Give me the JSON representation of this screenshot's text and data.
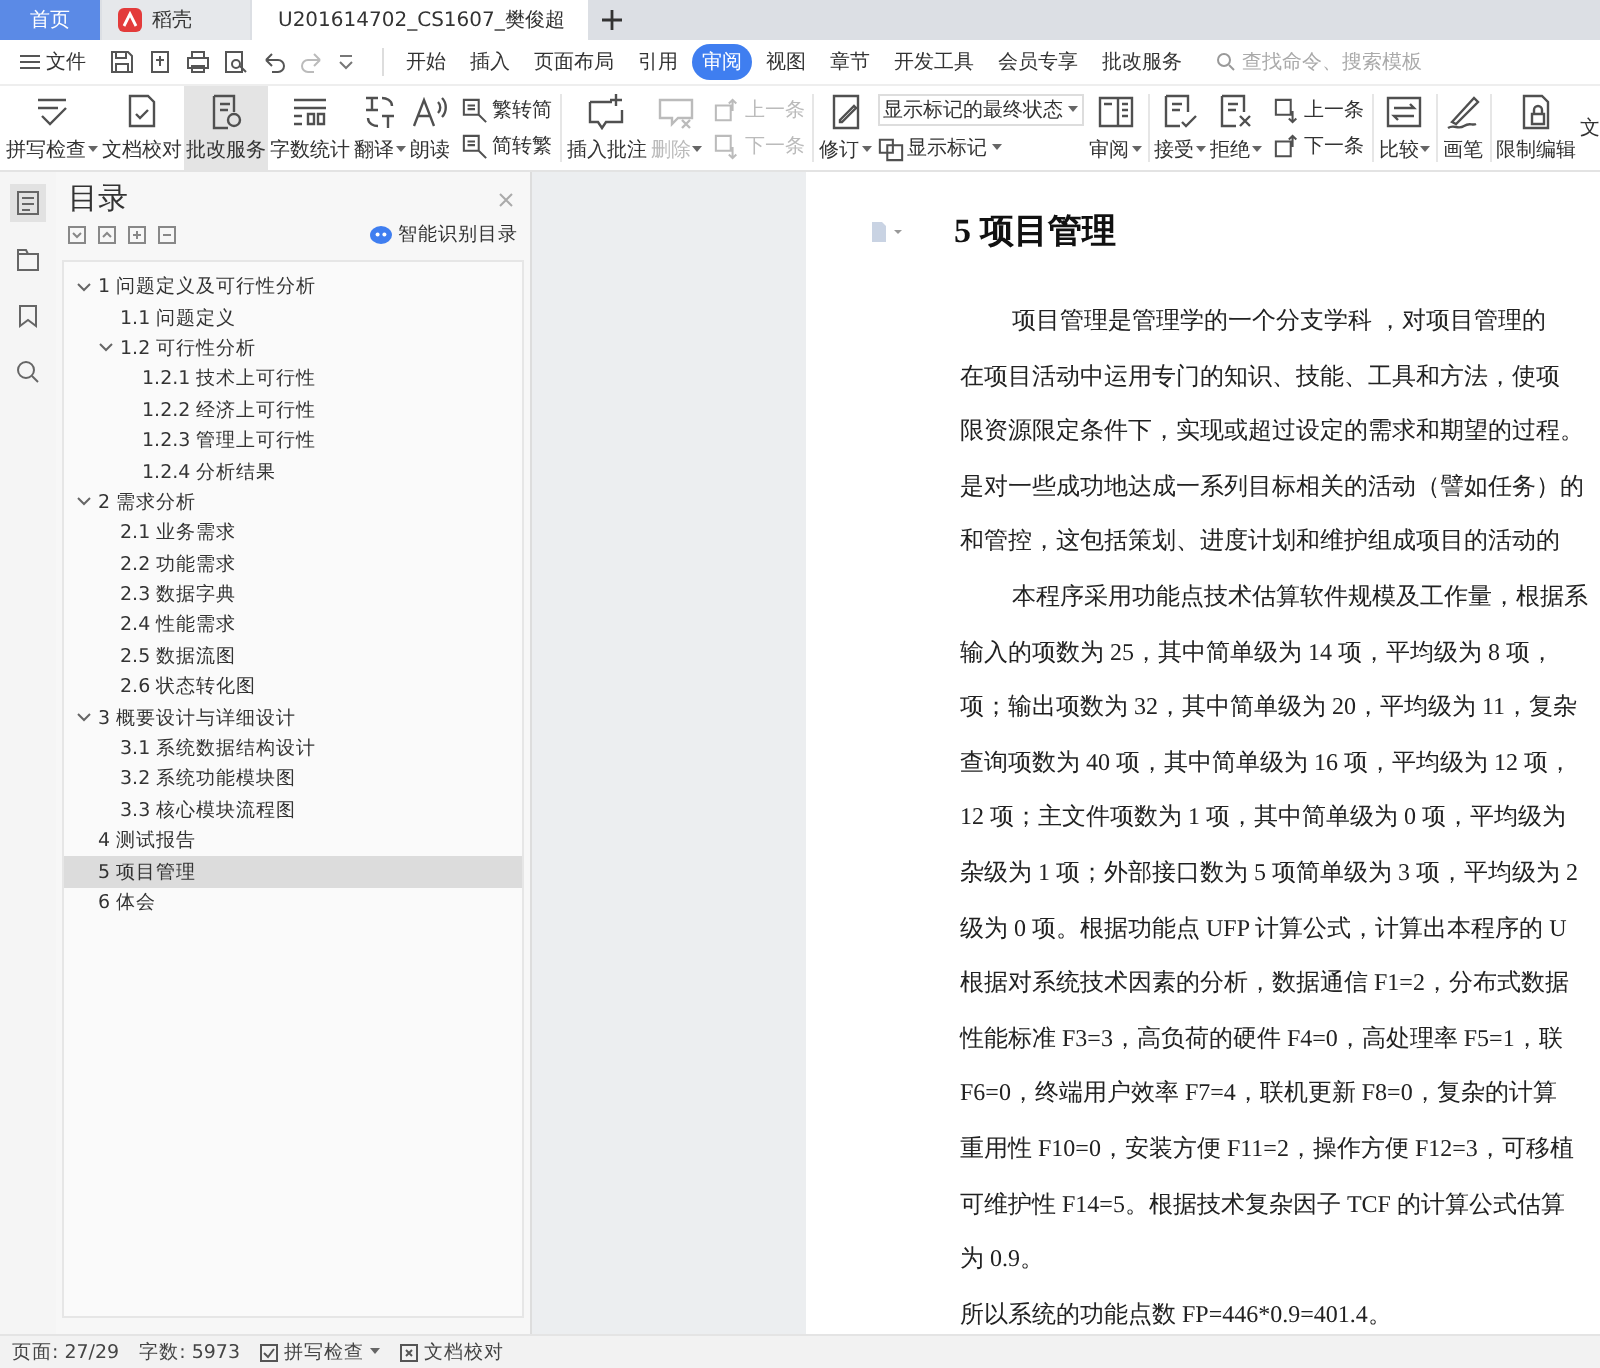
{
  "tabs": [
    {
      "label": "首页",
      "selected": false,
      "kind": "home"
    },
    {
      "label": "稻壳",
      "selected": false,
      "kind": "docer"
    },
    {
      "label": "U201614702_CS1607_樊俊超",
      "selected": true,
      "kind": "document"
    }
  ],
  "menu": {
    "file": "文件",
    "tabs": [
      {
        "label": "开始",
        "selected": false
      },
      {
        "label": "插入",
        "selected": false
      },
      {
        "label": "页面布局",
        "selected": false
      },
      {
        "label": "引用",
        "selected": false
      },
      {
        "label": "审阅",
        "selected": true
      },
      {
        "label": "视图",
        "selected": false
      },
      {
        "label": "章节",
        "selected": false
      },
      {
        "label": "开发工具",
        "selected": false
      },
      {
        "label": "会员专享",
        "selected": false
      },
      {
        "label": "批改服务",
        "selected": false
      }
    ],
    "search": {
      "placeholder": "查找命令、搜索模板"
    }
  },
  "ribbon": [
    {
      "items": [
        {
          "kind": "large",
          "label": "拼写检查",
          "dropdown": true,
          "disabled": false,
          "highlighted": false
        },
        {
          "kind": "large",
          "label": "文档校对",
          "dropdown": false,
          "disabled": false,
          "highlighted": false
        },
        {
          "kind": "large",
          "label": "批改服务",
          "dropdown": false,
          "disabled": false,
          "highlighted": true
        },
        {
          "kind": "large",
          "label": "字数统计",
          "dropdown": false,
          "disabled": false,
          "highlighted": false
        },
        {
          "kind": "large",
          "label": "翻译",
          "dropdown": true,
          "disabled": false,
          "highlighted": false
        },
        {
          "kind": "large",
          "label": "朗读",
          "dropdown": false,
          "disabled": false,
          "highlighted": false
        },
        {
          "kind": "pair",
          "items": [
            {
              "label": "繁转简",
              "dropdown": false,
              "disabled": false
            },
            {
              "label": "简转繁",
              "dropdown": false,
              "disabled": false
            }
          ]
        }
      ]
    },
    {
      "items": [
        {
          "kind": "large",
          "label": "插入批注",
          "dropdown": false,
          "disabled": false,
          "highlighted": false
        },
        {
          "kind": "large",
          "label": "删除",
          "dropdown": true,
          "disabled": true,
          "highlighted": false
        },
        {
          "kind": "pair",
          "items": [
            {
              "label": "上一条",
              "dropdown": false,
              "disabled": true
            },
            {
              "label": "下一条",
              "dropdown": false,
              "disabled": true
            }
          ]
        }
      ]
    },
    {
      "items": [
        {
          "kind": "large",
          "label": "修订",
          "dropdown": true,
          "disabled": false,
          "highlighted": false
        },
        {
          "kind": "select",
          "value": "显示标记的最终状态",
          "item": {
            "label": "显示标记",
            "dropdown": true,
            "disabled": false
          }
        },
        {
          "kind": "large",
          "label": "审阅",
          "dropdown": true,
          "disabled": false,
          "highlighted": false
        }
      ]
    },
    {
      "items": [
        {
          "kind": "large",
          "label": "接受",
          "dropdown": true,
          "disabled": false,
          "highlighted": false
        },
        {
          "kind": "large",
          "label": "拒绝",
          "dropdown": true,
          "disabled": false,
          "highlighted": false
        },
        {
          "kind": "pair",
          "items": [
            {
              "label": "上一条",
              "dropdown": false,
              "disabled": false
            },
            {
              "label": "下一条",
              "dropdown": false,
              "disabled": false
            }
          ]
        }
      ]
    },
    {
      "items": [
        {
          "kind": "large",
          "label": "比较",
          "dropdown": true,
          "disabled": false,
          "highlighted": false
        }
      ]
    },
    {
      "items": [
        {
          "kind": "large",
          "label": "画笔",
          "dropdown": false,
          "disabled": false,
          "highlighted": false
        }
      ]
    },
    {
      "items": [
        {
          "kind": "large",
          "label": "限制编辑",
          "dropdown": false,
          "disabled": false,
          "highlighted": false
        },
        {
          "kind": "label",
          "label": "文"
        }
      ]
    }
  ],
  "sidebar": {
    "title": "目录",
    "smart_toc": "智能识别目录",
    "toc": [
      {
        "label": "1 问题定义及可行性分析",
        "selected": false,
        "expanded": true,
        "children": [
          {
            "label": "1.1 问题定义",
            "selected": false
          },
          {
            "label": "1.2 可行性分析",
            "selected": false,
            "expanded": true,
            "children": [
              {
                "label": "1.2.1 技术上可行性",
                "selected": false
              },
              {
                "label": "1.2.2 经济上可行性",
                "selected": false
              },
              {
                "label": "1.2.3 管理上可行性",
                "selected": false
              },
              {
                "label": "1.2.4 分析结果",
                "selected": false
              }
            ]
          }
        ]
      },
      {
        "label": "2 需求分析",
        "selected": false,
        "expanded": true,
        "children": [
          {
            "label": "2.1 业务需求",
            "selected": false
          },
          {
            "label": "2.2 功能需求",
            "selected": false
          },
          {
            "label": "2.3 数据字典",
            "selected": false
          },
          {
            "label": "2.4 性能需求",
            "selected": false
          },
          {
            "label": "2.5 数据流图",
            "selected": false
          },
          {
            "label": "2.6 状态转化图",
            "selected": false
          }
        ]
      },
      {
        "label": "3 概要设计与详细设计",
        "selected": false,
        "expanded": true,
        "children": [
          {
            "label": "3.1 系统数据结构设计",
            "selected": false
          },
          {
            "label": "3.2 系统功能模块图",
            "selected": false
          },
          {
            "label": "3.3 核心模块流程图",
            "selected": false
          }
        ]
      },
      {
        "label": "4 测试报告",
        "selected": false
      },
      {
        "label": "5 项目管理",
        "selected": true
      },
      {
        "label": "6 体会",
        "selected": false
      }
    ]
  },
  "document": {
    "heading": "5 项目管理",
    "lines": [
      {
        "text": "项目管理是管理学的一个分支学科 ，对项目管理的",
        "indent": true
      },
      {
        "text": "在项目活动中运用专门的知识、技能、工具和方法，使项",
        "indent": false
      },
      {
        "text": "限资源限定条件下，实现或超过设定的需求和期望的过程。",
        "indent": false
      },
      {
        "text": "是对一些成功地达成一系列目标相关的活动（譬如任务）的",
        "indent": false
      },
      {
        "text": "和管控，这包括策划、进度计划和维护组成项目的活动的",
        "indent": false
      },
      {
        "text": "本程序采用功能点技术估算软件规模及工作量，根据系",
        "indent": true
      },
      {
        "text": "输入的项数为 25，其中简单级为 14 项，平均级为 8 项，",
        "indent": false
      },
      {
        "text": "项；输出项数为 32，其中简单级为 20，平均级为 11，复杂",
        "indent": false
      },
      {
        "text": "查询项数为 40 项，其中简单级为 16 项，平均级为 12 项，",
        "indent": false
      },
      {
        "text": "12 项；主文件项数为 1 项，其中简单级为 0 项，平均级为",
        "indent": false
      },
      {
        "text": "杂级为 1 项；外部接口数为 5 项简单级为 3 项，平均级为 2",
        "indent": false
      },
      {
        "text": "级为 0 项。根据功能点 UFP 计算公式，计算出本程序的 U",
        "indent": false
      },
      {
        "text": "根据对系统技术因素的分析，数据通信 F1=2，分布式数据",
        "indent": false
      },
      {
        "text": "性能标准 F3=3，高负荷的硬件 F4=0，高处理率 F5=1，联",
        "indent": false
      },
      {
        "text": "F6=0，终端用户效率 F7=4，联机更新 F8=0，复杂的计算",
        "indent": false
      },
      {
        "text": "重用性 F10=0，安装方便 F11=2，操作方便 F12=3，可移植",
        "indent": false
      },
      {
        "text": "可维护性 F14=5。根据技术复杂因子 TCF 的计算公式估算",
        "indent": false
      },
      {
        "text": "为 0.9。",
        "indent": false
      },
      {
        "text": "所以系统的功能点数 FP=446*0.9=401.4。",
        "indent": false
      }
    ]
  },
  "status_bar": {
    "page": "页面: 27/29",
    "words": "字数: 5973",
    "spell_check": "拼写检查",
    "proofread": "文档校对"
  }
}
